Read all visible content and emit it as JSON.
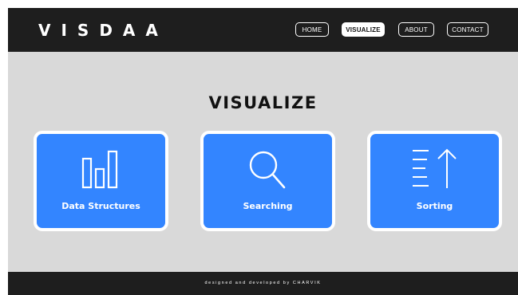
{
  "header": {
    "logo": "VISDAA",
    "nav": [
      {
        "label": "HOME",
        "active": false
      },
      {
        "label": "VISUALIZE",
        "active": true
      },
      {
        "label": "ABOUT",
        "active": false
      },
      {
        "label": "CONTACT",
        "active": false
      }
    ]
  },
  "main": {
    "title": "VISUALIZE",
    "cards": [
      {
        "label": "Data Structures",
        "icon": "bar-chart-icon"
      },
      {
        "label": "Searching",
        "icon": "magnifier-icon"
      },
      {
        "label": "Sorting",
        "icon": "sort-ascending-icon"
      }
    ]
  },
  "footer": {
    "text": "designed and developed by CHARVIK"
  },
  "colors": {
    "header_bg": "#1e1e1e",
    "page_bg": "#d9d9d9",
    "card_bg": "#3385ff",
    "card_border": "#ffffff",
    "text_dark": "#111111",
    "text_light": "#ffffff"
  }
}
